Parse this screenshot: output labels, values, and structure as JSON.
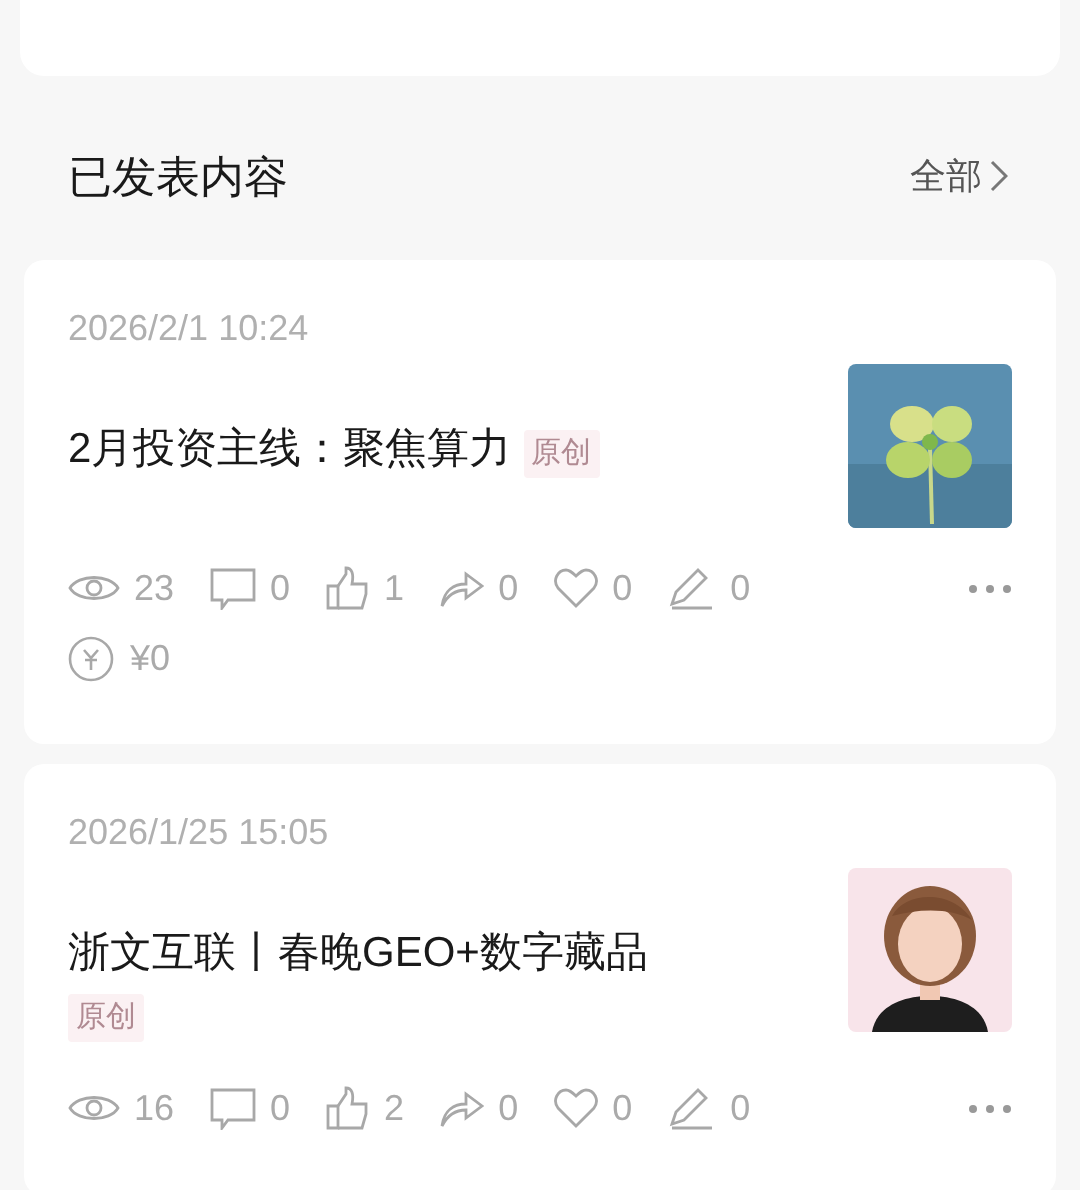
{
  "section": {
    "title": "已发表内容",
    "link": "全部"
  },
  "posts": [
    {
      "date": "2026/2/1 10:24",
      "title": "2月投资主线：聚焦算力",
      "tag": "原创",
      "stats": [
        {
          "kind": "views",
          "value": "23"
        },
        {
          "kind": "comments",
          "value": "0"
        },
        {
          "kind": "likes",
          "value": "1"
        },
        {
          "kind": "shares",
          "value": "0"
        },
        {
          "kind": "favorites",
          "value": "0"
        },
        {
          "kind": "edits",
          "value": "0"
        }
      ],
      "earnings": "¥0"
    },
    {
      "date": "2026/1/25 15:05",
      "title": "浙文互联丨春晚GEO+数字藏品",
      "tag": "原创",
      "stats": [
        {
          "kind": "views",
          "value": "16"
        },
        {
          "kind": "comments",
          "value": "0"
        },
        {
          "kind": "likes",
          "value": "2"
        },
        {
          "kind": "shares",
          "value": "0"
        },
        {
          "kind": "favorites",
          "value": "0"
        },
        {
          "kind": "edits",
          "value": "0"
        }
      ]
    }
  ]
}
